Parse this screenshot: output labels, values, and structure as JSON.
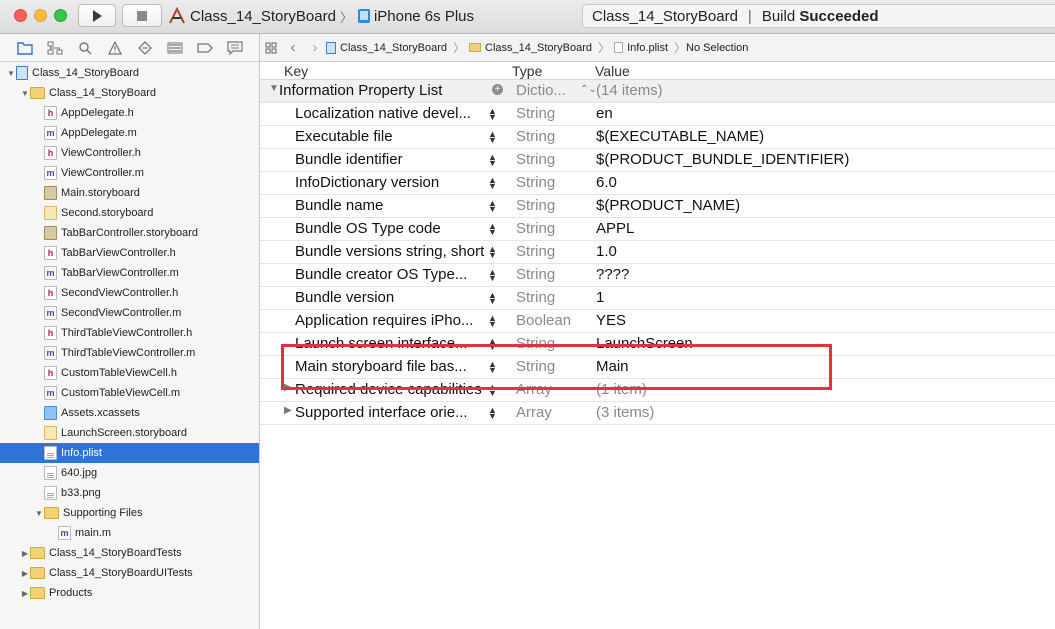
{
  "toolbar": {
    "scheme": {
      "project": "Class_14_StoryBoard",
      "device": "iPhone 6s Plus"
    },
    "activity": {
      "project": "Class_14_StoryBoard",
      "status_prefix": "Build",
      "status": "Succeeded"
    }
  },
  "navigator": {
    "tree": [
      {
        "label": "Class_14_StoryBoard",
        "kind": "proj",
        "depth": 0,
        "disclosure": "open"
      },
      {
        "label": "Class_14_StoryBoard",
        "kind": "folder",
        "depth": 1,
        "disclosure": "open"
      },
      {
        "label": "AppDelegate.h",
        "kind": "h",
        "depth": 2
      },
      {
        "label": "AppDelegate.m",
        "kind": "m",
        "depth": 2
      },
      {
        "label": "ViewController.h",
        "kind": "h",
        "depth": 2
      },
      {
        "label": "ViewController.m",
        "kind": "m",
        "depth": 2
      },
      {
        "label": "Main.storyboard",
        "kind": "sb",
        "depth": 2
      },
      {
        "label": "Second.storyboard",
        "kind": "sbl",
        "depth": 2
      },
      {
        "label": "TabBarController.storyboard",
        "kind": "sb",
        "depth": 2
      },
      {
        "label": "TabBarViewController.h",
        "kind": "h",
        "depth": 2
      },
      {
        "label": "TabBarViewController.m",
        "kind": "m",
        "depth": 2
      },
      {
        "label": "SecondViewController.h",
        "kind": "h",
        "depth": 2
      },
      {
        "label": "SecondViewController.m",
        "kind": "m",
        "depth": 2
      },
      {
        "label": "ThirdTableViewController.h",
        "kind": "h",
        "depth": 2
      },
      {
        "label": "ThirdTableViewController.m",
        "kind": "m",
        "depth": 2
      },
      {
        "label": "CustomTableViewCell.h",
        "kind": "h",
        "depth": 2
      },
      {
        "label": "CustomTableViewCell.m",
        "kind": "m",
        "depth": 2
      },
      {
        "label": "Assets.xcassets",
        "kind": "xc",
        "depth": 2
      },
      {
        "label": "LaunchScreen.storyboard",
        "kind": "sbl",
        "depth": 2
      },
      {
        "label": "Info.plist",
        "kind": "plist",
        "depth": 2,
        "selected": true
      },
      {
        "label": "640.jpg",
        "kind": "img",
        "depth": 2
      },
      {
        "label": "b33.png",
        "kind": "img",
        "depth": 2
      },
      {
        "label": "Supporting Files",
        "kind": "folder",
        "depth": 2,
        "disclosure": "open"
      },
      {
        "label": "main.m",
        "kind": "m",
        "depth": 3
      },
      {
        "label": "Class_14_StoryBoardTests",
        "kind": "folder",
        "depth": 1,
        "disclosure": "closed"
      },
      {
        "label": "Class_14_StoryBoardUITests",
        "kind": "folder",
        "depth": 1,
        "disclosure": "closed"
      },
      {
        "label": "Products",
        "kind": "folder",
        "depth": 1,
        "disclosure": "closed"
      }
    ]
  },
  "jumpbar": {
    "crumbs": [
      "Class_14_StoryBoard",
      "Class_14_StoryBoard",
      "Info.plist",
      "No Selection"
    ]
  },
  "plist": {
    "headers": {
      "key": "Key",
      "type": "Type",
      "value": "Value"
    },
    "root": {
      "key": "Information Property List",
      "type": "Dictio...",
      "value": "(14 items)"
    },
    "rows": [
      {
        "key": "Localization native devel...",
        "type": "String",
        "value": "en"
      },
      {
        "key": "Executable file",
        "type": "String",
        "value": "$(EXECUTABLE_NAME)"
      },
      {
        "key": "Bundle identifier",
        "type": "String",
        "value": "$(PRODUCT_BUNDLE_IDENTIFIER)"
      },
      {
        "key": "InfoDictionary version",
        "type": "String",
        "value": "6.0"
      },
      {
        "key": "Bundle name",
        "type": "String",
        "value": "$(PRODUCT_NAME)"
      },
      {
        "key": "Bundle OS Type code",
        "type": "String",
        "value": "APPL"
      },
      {
        "key": "Bundle versions string, short",
        "type": "String",
        "value": "1.0"
      },
      {
        "key": "Bundle creator OS Type...",
        "type": "String",
        "value": "????"
      },
      {
        "key": "Bundle version",
        "type": "String",
        "value": "1"
      },
      {
        "key": "Application requires iPho...",
        "type": "Boolean",
        "value": "YES"
      },
      {
        "key": "Launch screen interface...",
        "type": "String",
        "value": "LaunchScreen"
      },
      {
        "key": "Main storyboard file bas...",
        "type": "String",
        "value": "Main"
      },
      {
        "key": "Required device capabilities",
        "type": "Array",
        "value": "(1 item)",
        "expandable": true
      },
      {
        "key": "Supported interface orie...",
        "type": "Array",
        "value": "(3 items)",
        "expandable": true
      }
    ]
  },
  "colors": {
    "selection": "#2f73d8",
    "highlight": "#e2333a"
  }
}
